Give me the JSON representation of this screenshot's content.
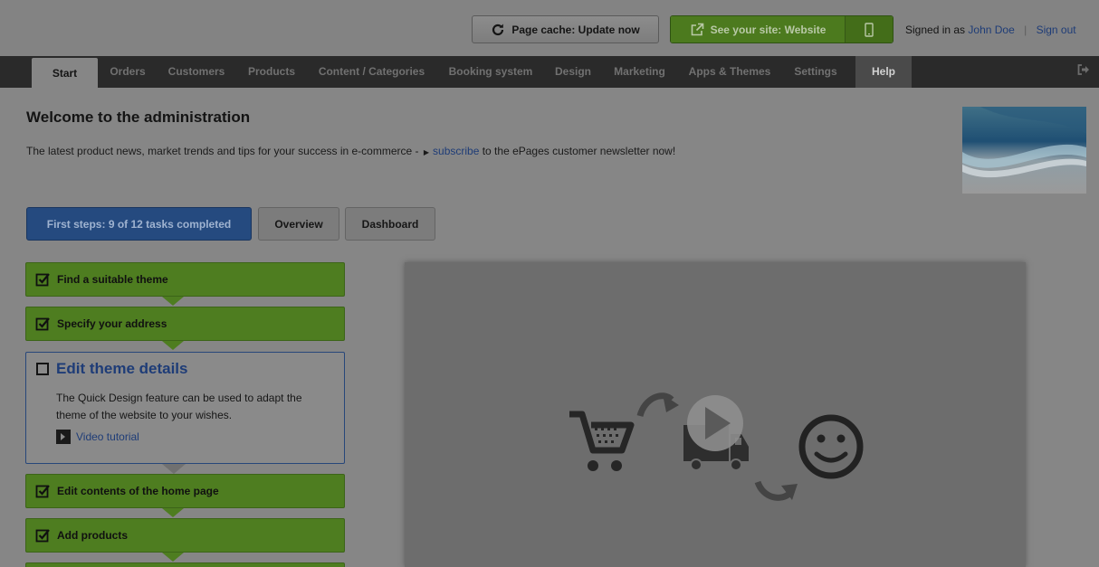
{
  "header": {
    "cache_button": "Page cache: Update now",
    "site_button": "See your site: Website",
    "signed_in_prefix": "Signed in as",
    "user_name": "John Doe",
    "separator": "|",
    "sign_out": "Sign out"
  },
  "nav": {
    "items": [
      {
        "label": "Start"
      },
      {
        "label": "Orders"
      },
      {
        "label": "Customers"
      },
      {
        "label": "Products"
      },
      {
        "label": "Content / Categories"
      },
      {
        "label": "Booking system"
      },
      {
        "label": "Design"
      },
      {
        "label": "Marketing"
      },
      {
        "label": "Apps & Themes"
      },
      {
        "label": "Settings"
      },
      {
        "label": "Help"
      }
    ],
    "active": "Start"
  },
  "main": {
    "title": "Welcome to the administration",
    "news_prefix": "The latest product news, market trends and tips for your success in e-commerce -",
    "news_link": "subscribe",
    "news_suffix": "to the ePages customer newsletter now!"
  },
  "tabs": [
    {
      "label": "First steps: 9 of 12 tasks completed"
    },
    {
      "label": "Overview"
    },
    {
      "label": "Dashboard"
    }
  ],
  "steps": [
    {
      "label": "Find a suitable theme",
      "done": true
    },
    {
      "label": "Specify your address",
      "done": true
    },
    {
      "label": "Edit theme details",
      "done": false,
      "description": "The Quick Design feature can be used to adapt the theme of the website to your wishes.",
      "video_link": "Video tutorial"
    },
    {
      "label": "Edit contents of the home page",
      "done": true
    },
    {
      "label": "Add products",
      "done": true
    }
  ],
  "colors": {
    "overlay_gray": "#868686",
    "nav_dark": "#2a2a2a",
    "step_green": "#4e7d20",
    "link_blue": "#1e3c77",
    "tab_blue": "#254a7f"
  },
  "icons": [
    "refresh-icon",
    "external-link-icon",
    "mobile-icon",
    "logout-icon",
    "checkbox-checked-icon",
    "checkbox-empty-icon",
    "play-icon",
    "cart-icon",
    "truck-icon",
    "smiley-icon",
    "curved-arrow-icon"
  ]
}
